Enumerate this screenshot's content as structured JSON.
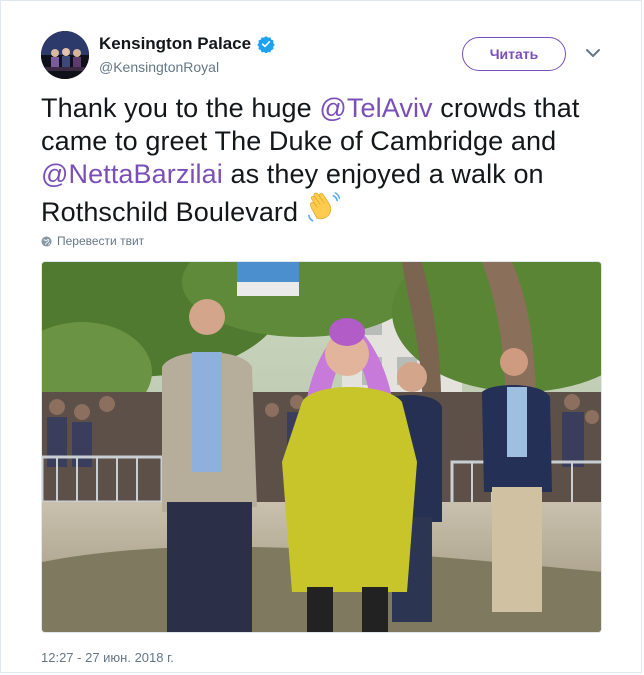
{
  "account": {
    "display_name": "Kensington Palace",
    "handle": "@KensingtonRoyal",
    "verified_icon": "verified-badge-icon"
  },
  "actions": {
    "follow_label": "Читать",
    "menu_icon": "chevron-down-icon"
  },
  "tweet": {
    "text_part1": "Thank you to the huge ",
    "mention1": "@TelAviv",
    "text_part2": " crowds that came to greet The Duke of Cambridge and ",
    "mention2": "@NettaBarzilai",
    "text_part3": " as they enjoyed a walk on Rothschild Boulevard ",
    "emoji": "waving-hand-emoji"
  },
  "translate_label": "Перевести твит",
  "timestamp": "12:27 - 27 июн. 2018 г.",
  "colors": {
    "accent": "#7a4fb8",
    "verified": "#1da1f2",
    "text": "#14171a",
    "muted": "#657786"
  }
}
